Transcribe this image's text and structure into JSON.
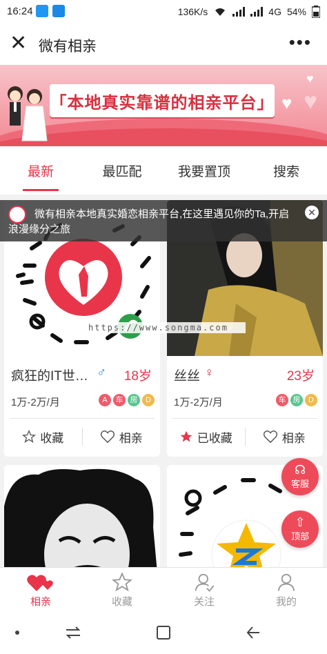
{
  "status_bar": {
    "time": "16:24",
    "speed": "136K/s",
    "network": "4G",
    "battery": "54%"
  },
  "title_bar": {
    "title": "微有相亲"
  },
  "banner": {
    "slogan": "「本地真实靠谱的相亲平台」"
  },
  "tabs": [
    {
      "label": "最新",
      "active": true
    },
    {
      "label": "最匹配",
      "active": false
    },
    {
      "label": "我要置顶",
      "active": false
    },
    {
      "label": "搜索",
      "active": false
    }
  ],
  "notice": {
    "text": "微有相亲本地真实婚恋相亲平台,在这里遇见你的Ta,开启浪漫缘分之旅"
  },
  "watermark": "https://www.songma.com",
  "cards": [
    {
      "name": "疯狂的IT世…",
      "gender": "male",
      "gender_symbol": "♂",
      "age": "18岁",
      "income": "1万-2万/月",
      "tags": [
        {
          "label": "A",
          "color": "#ef5b6b"
        },
        {
          "label": "车",
          "color": "#ef5b6b"
        },
        {
          "label": "房",
          "color": "#5cc48f"
        },
        {
          "label": "D",
          "color": "#f0b94a"
        }
      ],
      "fav_label": "收藏",
      "favorited": false,
      "match_label": "相亲"
    },
    {
      "name": "丝丝",
      "gender": "female",
      "gender_symbol": "♀",
      "age": "23岁",
      "income": "1万-2万/月",
      "tags": [
        {
          "label": "车",
          "color": "#ef5b6b"
        },
        {
          "label": "房",
          "color": "#5cc48f"
        },
        {
          "label": "D",
          "color": "#f0b94a"
        }
      ],
      "fav_label": "已收藏",
      "favorited": true,
      "match_label": "相亲"
    }
  ],
  "float_buttons": {
    "service": "客服",
    "top": "顶部"
  },
  "bottom_nav": [
    {
      "label": "相亲",
      "icon": "hearts-icon",
      "active": true
    },
    {
      "label": "收藏",
      "icon": "star-icon",
      "active": false
    },
    {
      "label": "关注",
      "icon": "user-check-icon",
      "active": false
    },
    {
      "label": "我的",
      "icon": "user-icon",
      "active": false
    }
  ],
  "colors": {
    "accent": "#e8354a",
    "tag_red": "#ef5b6b",
    "tag_green": "#5cc48f",
    "tag_yellow": "#f0b94a"
  }
}
